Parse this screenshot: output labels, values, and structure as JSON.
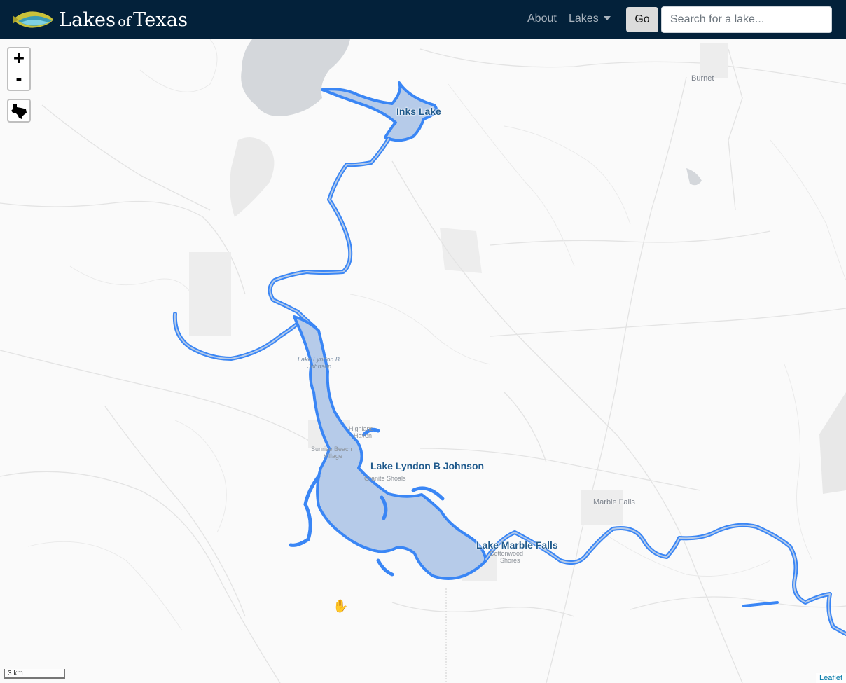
{
  "navbar": {
    "brand_word1": "Lakes",
    "brand_of": "of",
    "brand_word2": "Texas",
    "about_label": "About",
    "lakes_label": "Lakes",
    "go_label": "Go",
    "search_placeholder": "Search for a lake..."
  },
  "icons": {
    "logo": "fish-logo-icon",
    "texas": "texas-state-icon",
    "dropdown": "caret-down-icon",
    "cursor": "hand-cursor-icon"
  },
  "map": {
    "zoom_in_label": "+",
    "zoom_out_label": "-",
    "lake_labels": {
      "inks": "Inks Lake",
      "lbj": "Lake Lyndon B Johnson",
      "marble": "Lake Marble Falls"
    },
    "towns": {
      "burnet": "Burnet",
      "marble_falls": "Marble Falls",
      "granite_shoals": "Granite Shoals",
      "cottonwood_1": "Cottonwood",
      "cottonwood_2": "Shores",
      "highland_1": "Highland",
      "highland_2": "Haven",
      "sunrise_1": "Sunrise Beach",
      "sunrise_2": "Village"
    },
    "basemap_lake_1": "Lake Lyndon B.",
    "basemap_lake_2": "Johnson",
    "scale_label": "3 km",
    "attribution": "Leaflet"
  },
  "colors": {
    "navbar": "#03213a",
    "lake_stroke": "#3a86f5",
    "lake_fill": "#b6cbe9"
  }
}
